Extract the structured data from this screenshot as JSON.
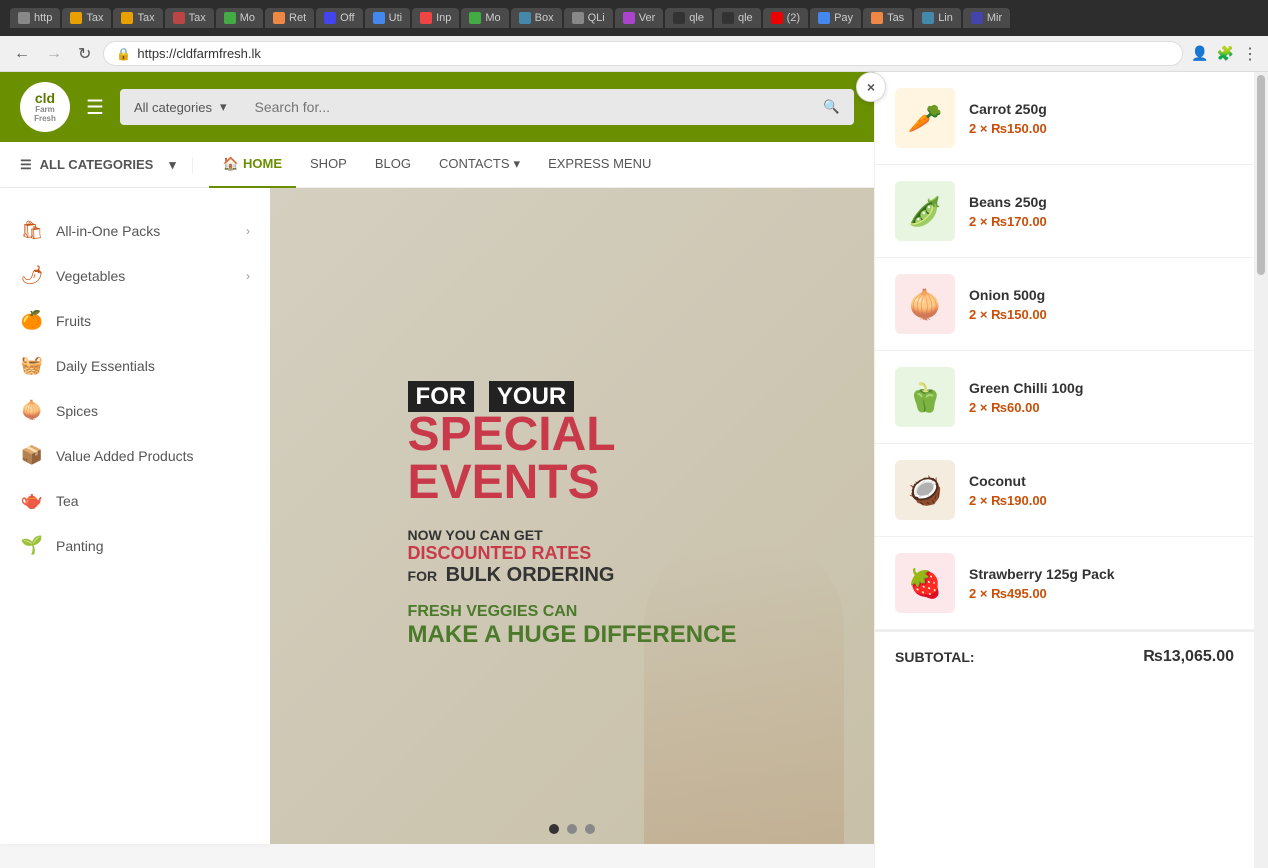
{
  "browser": {
    "address": "https://cldfarmfresh.lk",
    "tabs": [
      {
        "label": "http",
        "active": false
      },
      {
        "label": "Tax",
        "active": false
      },
      {
        "label": "Tax",
        "active": false
      },
      {
        "label": "Tax",
        "active": false
      },
      {
        "label": "Mo",
        "active": false
      },
      {
        "label": "Ret",
        "active": false
      },
      {
        "label": "Off",
        "active": false
      },
      {
        "label": "Uti",
        "active": false
      },
      {
        "label": "Inp",
        "active": false
      },
      {
        "label": "Mo",
        "active": false
      },
      {
        "label": "Box",
        "active": false
      },
      {
        "label": "QLi",
        "active": false
      },
      {
        "label": "Ver",
        "active": false
      },
      {
        "label": "qle",
        "active": false
      },
      {
        "label": "qle",
        "active": false
      },
      {
        "label": "(2)",
        "active": false
      },
      {
        "label": "Pay",
        "active": false
      },
      {
        "label": "Tas",
        "active": false
      },
      {
        "label": "Lin",
        "active": false
      },
      {
        "label": "Mir",
        "active": false
      }
    ]
  },
  "header": {
    "logo_text": "cld\nFarm\nFresh",
    "category_placeholder": "All categories",
    "search_placeholder": "Search for..."
  },
  "nav": {
    "all_categories": "ALL CATEGORIES",
    "links": [
      {
        "label": "HOME",
        "active": true,
        "has_icon": true
      },
      {
        "label": "SHOP",
        "active": false
      },
      {
        "label": "BLOG",
        "active": false
      },
      {
        "label": "CONTACTS",
        "active": false,
        "has_dropdown": true
      },
      {
        "label": "EXPRESS MENU",
        "active": false
      }
    ]
  },
  "sidebar": {
    "items": [
      {
        "label": "All-in-One Packs",
        "icon": "🛍",
        "has_arrow": true
      },
      {
        "label": "Vegetables",
        "icon": "🌶",
        "has_arrow": true
      },
      {
        "label": "Fruits",
        "icon": "🍊",
        "has_arrow": false
      },
      {
        "label": "Daily Essentials",
        "icon": "🧺",
        "has_arrow": false
      },
      {
        "label": "Spices",
        "icon": "🧅",
        "has_arrow": false
      },
      {
        "label": "Value Added Products",
        "icon": "📦",
        "has_arrow": false
      },
      {
        "label": "Tea",
        "icon": "🫖",
        "has_arrow": false
      },
      {
        "label": "Panting",
        "icon": "🌱",
        "has_arrow": false
      }
    ]
  },
  "banner": {
    "line1_prefix": "FOR YOUR",
    "line2": "SPECIAL",
    "line3": "EVENTS",
    "sub1": "NOW YOU CAN GET",
    "sub2": "DISCOUNTED RATES",
    "sub3": "FOR",
    "sub4": "BULK ORDERING",
    "accent1": "FRESH VEGGIES CAN",
    "accent2": "MAKE A HUGE DIFFERENCE",
    "dots": [
      true,
      false,
      false
    ]
  },
  "cart": {
    "close_label": "×",
    "items": [
      {
        "name": "Carrot 250g",
        "qty": "2",
        "price": "150.00",
        "emoji": "🥕"
      },
      {
        "name": "Beans 250g",
        "qty": "2",
        "price": "170.00",
        "emoji": "🫛"
      },
      {
        "name": "Onion 500g",
        "qty": "2",
        "price": "150.00",
        "emoji": "🧅"
      },
      {
        "name": "Green Chilli 100g",
        "qty": "2",
        "price": "60.00",
        "emoji": "🫑"
      },
      {
        "name": "Coconut",
        "qty": "2",
        "price": "190.00",
        "emoji": "🥥"
      },
      {
        "name": "Strawberry 125g Pack",
        "qty": "2",
        "price": "495.00",
        "emoji": "🍓"
      }
    ],
    "subtotal_label": "SUBTOTAL:",
    "subtotal_currency": "₨",
    "subtotal_value": "13,065.00"
  }
}
